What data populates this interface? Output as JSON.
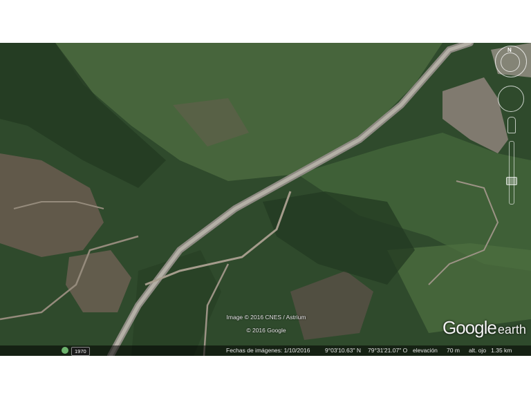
{
  "attribution": {
    "imagery": "Image © 2016 CNES / Astrium",
    "copyright": "© 2016 Google"
  },
  "logo": {
    "google": "Google",
    "earth": "earth"
  },
  "statusbar": {
    "year": "1970",
    "imagery_date": "Fechas de imágenes: 1/10/2016",
    "latitude": "9°03'10.63\" N",
    "longitude": "79°31'21.07\" O",
    "elevation_label": "elevación",
    "elevation_value": "70 m",
    "eye_alt": "alt. ojo   1.35 km"
  },
  "navigation": {
    "north_label": "N"
  },
  "colors": {
    "forest": "#2f4a2c",
    "grass": "#4d6b3e",
    "bare_soil": "#6f6253",
    "road": "#a7a39a"
  }
}
